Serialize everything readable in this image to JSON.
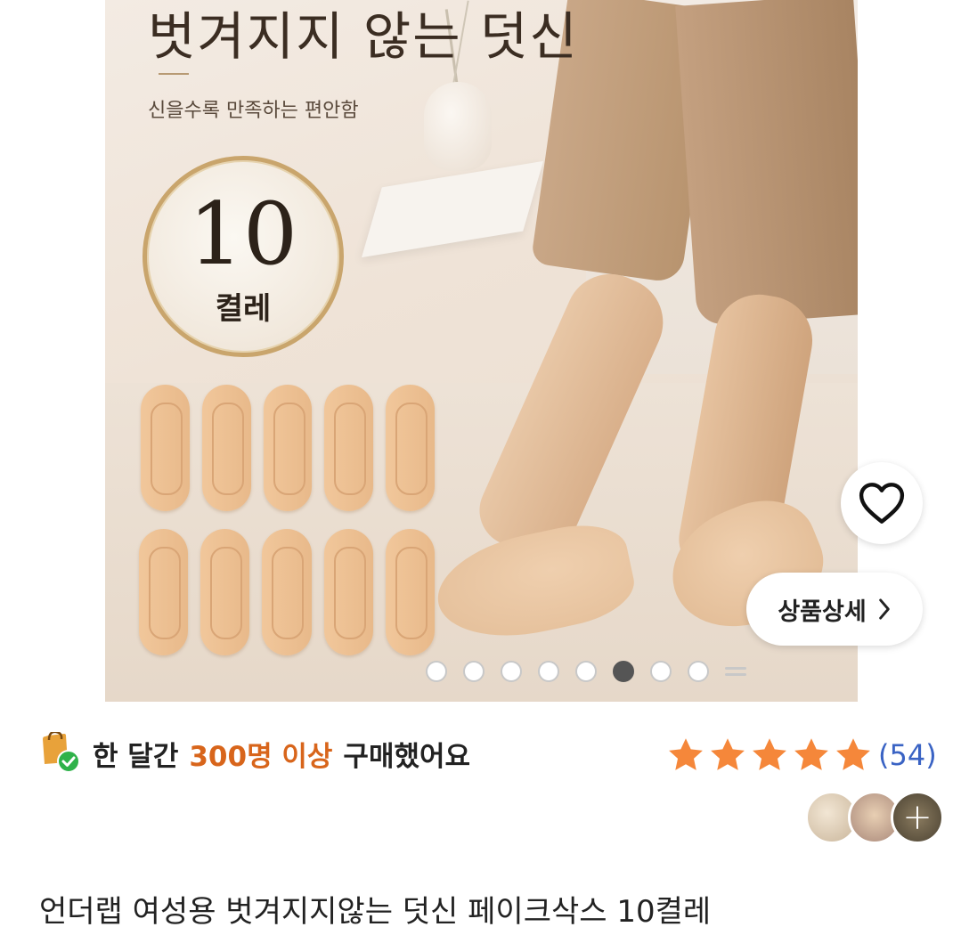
{
  "hero": {
    "title": "벗겨지지 않는 덧신",
    "subtitle": "신을수록 만족하는 편안함",
    "badge_number": "10",
    "badge_unit": "켤레",
    "image_count": 8,
    "active_image_index": 6
  },
  "buttons": {
    "wishlist_icon": "heart-icon",
    "detail_label": "상품상세",
    "detail_icon": "chevron-right-icon"
  },
  "purchase_info": {
    "prefix": "한 달간",
    "highlight": "300명 이상",
    "suffix": "구매했어요",
    "icon": "shopping-bag-check-icon",
    "highlight_color": "#d8651b"
  },
  "rating": {
    "stars": 5,
    "review_count": "(54)",
    "star_color": "#f5873a",
    "count_color": "#3a63c4"
  },
  "review_avatars": {
    "more_label": "+"
  },
  "product": {
    "title": "언더랩 여성용 벗겨지지않는 덧신 페이크삭스 10켤레"
  }
}
